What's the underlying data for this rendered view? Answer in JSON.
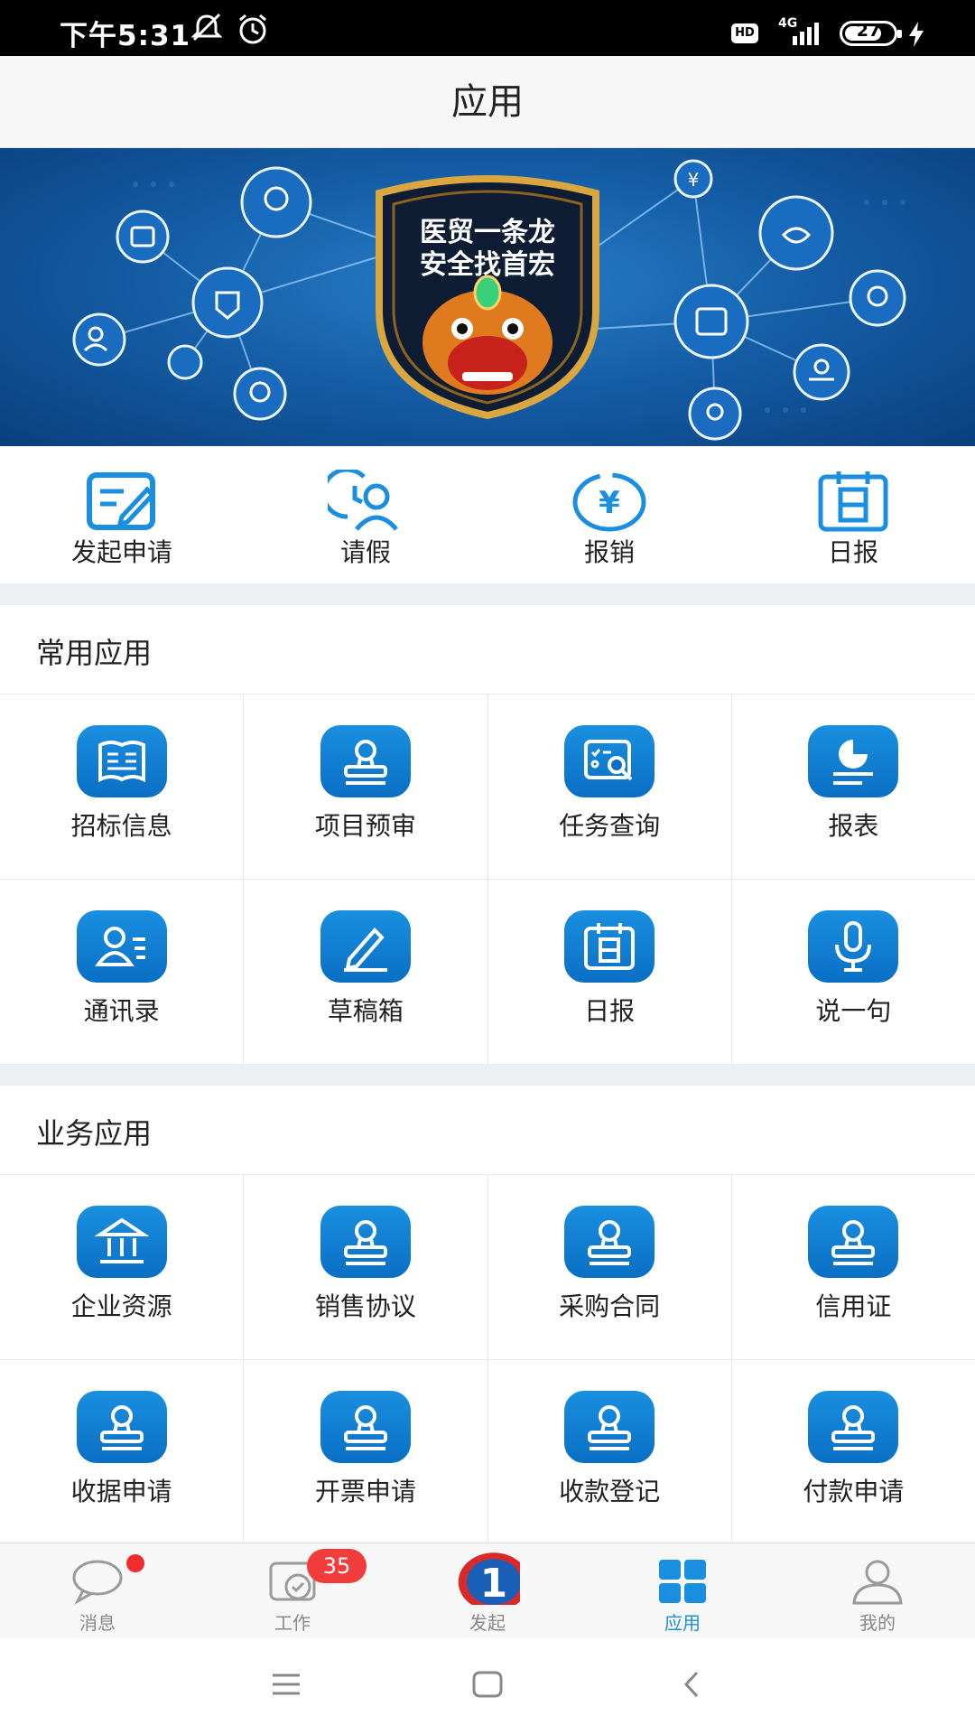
{
  "status_bar": {
    "time": "下午5:31",
    "network": "4G",
    "hd_label": "HD",
    "battery": "27",
    "icons": [
      "mute-icon",
      "alarm-icon",
      "hd-icon",
      "signal-icon",
      "battery-icon",
      "charging-icon"
    ]
  },
  "header": {
    "title": "应用"
  },
  "banner": {
    "line1": "医贸一条龙",
    "line2": "安全找首宏"
  },
  "quick_actions": [
    {
      "label": "发起申请",
      "icon": "edit-form-icon"
    },
    {
      "label": "请假",
      "icon": "leave-clock-user-icon"
    },
    {
      "label": "报销",
      "icon": "yen-icon"
    },
    {
      "label": "日报",
      "icon": "daily-calendar-icon"
    }
  ],
  "common_apps": {
    "title": "常用应用",
    "items": [
      {
        "label": "招标信息",
        "icon": "book-icon"
      },
      {
        "label": "项目预审",
        "icon": "stamp-icon"
      },
      {
        "label": "任务查询",
        "icon": "task-search-icon"
      },
      {
        "label": "报表",
        "icon": "chart-report-icon"
      },
      {
        "label": "通讯录",
        "icon": "contacts-icon"
      },
      {
        "label": "草稿箱",
        "icon": "pencil-icon"
      },
      {
        "label": "日报",
        "icon": "daily-calendar-icon"
      },
      {
        "label": "说一句",
        "icon": "microphone-icon"
      }
    ]
  },
  "business_apps": {
    "title": "业务应用",
    "items": [
      {
        "label": "企业资源",
        "icon": "bank-icon"
      },
      {
        "label": "销售协议",
        "icon": "stamp-icon"
      },
      {
        "label": "采购合同",
        "icon": "stamp-icon"
      },
      {
        "label": "信用证",
        "icon": "stamp-icon"
      },
      {
        "label": "收据申请",
        "icon": "stamp-icon"
      },
      {
        "label": "开票申请",
        "icon": "stamp-icon"
      },
      {
        "label": "收款登记",
        "icon": "stamp-icon"
      },
      {
        "label": "付款申请",
        "icon": "stamp-icon"
      }
    ]
  },
  "tabs": [
    {
      "label": "消息",
      "icon": "chat-bubble-icon",
      "has_dot": true
    },
    {
      "label": "工作",
      "icon": "work-check-icon",
      "badge": "35"
    },
    {
      "label": "发起",
      "icon": "launch-logo-icon",
      "logo_text": "1"
    },
    {
      "label": "应用",
      "icon": "grid-apps-icon",
      "active": true
    },
    {
      "label": "我的",
      "icon": "user-profile-icon"
    }
  ],
  "colors": {
    "accent": "#1a8fe0",
    "tile": "#0a6fc4",
    "badge": "#f23b3b",
    "banner": "#155fa8"
  }
}
